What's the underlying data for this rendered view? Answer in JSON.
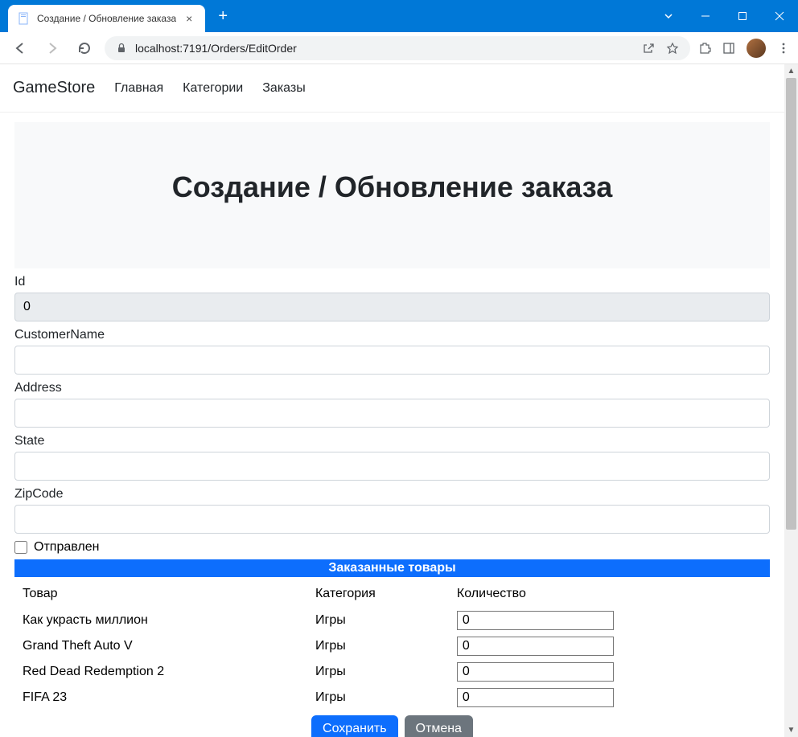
{
  "browser": {
    "tab_title": "Создание / Обновление заказа",
    "url": "localhost:7191/Orders/EditOrder"
  },
  "site": {
    "brand": "GameStore",
    "nav": [
      "Главная",
      "Категории",
      "Заказы"
    ]
  },
  "page_title": "Создание / Обновление заказа",
  "form": {
    "labels": {
      "id": "Id",
      "customer": "CustomerName",
      "address": "Address",
      "state": "State",
      "zip": "ZipCode",
      "shipped": "Отправлен"
    },
    "id_value": "0"
  },
  "items_section": {
    "title": "Заказанные товары",
    "columns": {
      "product": "Товар",
      "category": "Категория",
      "quantity": "Количество"
    },
    "rows": [
      {
        "product": "Как украсть миллион",
        "category": "Игры",
        "qty": "0"
      },
      {
        "product": "Grand Theft Auto V",
        "category": "Игры",
        "qty": "0"
      },
      {
        "product": "Red Dead Redemption 2",
        "category": "Игры",
        "qty": "0"
      },
      {
        "product": "FIFA 23",
        "category": "Игры",
        "qty": "0"
      }
    ]
  },
  "buttons": {
    "save": "Сохранить",
    "cancel": "Отмена"
  }
}
